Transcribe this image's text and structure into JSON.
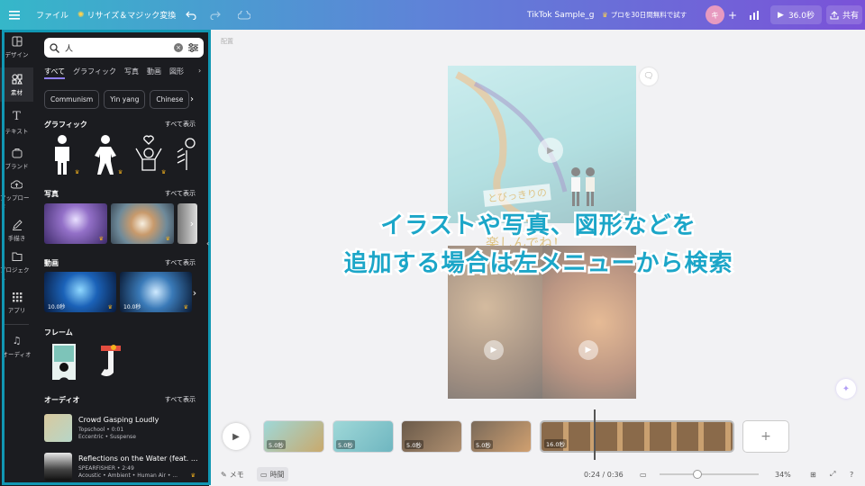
{
  "topbar": {
    "menu_icon": "hamburger-icon",
    "file_label": "ファイル",
    "resize_label": "リサイズ＆マジック変換",
    "title": "TikTok Sample_g",
    "trial_label": "プロを30日間無料で試す",
    "avatar_initial": "キ",
    "add_label": "+",
    "play_label": "36.0秒",
    "share_label": "共有"
  },
  "rail": {
    "items": [
      {
        "label": "デザイン",
        "icon": "layout-icon"
      },
      {
        "label": "素材",
        "icon": "elements-icon"
      },
      {
        "label": "テキスト",
        "icon": "text-icon"
      },
      {
        "label": "ブランド",
        "icon": "brand-icon"
      },
      {
        "label": "アップロード",
        "icon": "upload-icon"
      },
      {
        "label": "手描き",
        "icon": "draw-icon"
      },
      {
        "label": "プロジェクト",
        "icon": "folder-icon"
      },
      {
        "label": "アプリ",
        "icon": "apps-icon"
      },
      {
        "label": "オーディオ",
        "icon": "music-icon"
      }
    ]
  },
  "panel": {
    "search_value": "人",
    "tabs": [
      "すべて",
      "グラフィック",
      "写真",
      "動画",
      "図形"
    ],
    "chips": [
      "Communism",
      "Yin yang",
      "Chinese"
    ],
    "graphics_title": "グラフィック",
    "photos_title": "写真",
    "videos_title": "動画",
    "frames_title": "フレーム",
    "audio_title": "オーディオ",
    "see_all": "すべて表示",
    "videos": [
      {
        "duration": "10.0秒"
      },
      {
        "duration": "10.0秒"
      }
    ],
    "audio": [
      {
        "title": "Crowd Gasping Loudly",
        "meta": "Topschool • 0:01",
        "tags": "Eccentric • Suspense"
      },
      {
        "title": "Reflections on the Water (feat. ...",
        "meta": "SPEARFISHER • 2:49",
        "tags": "Acoustic • Ambient • Human Air • ..."
      }
    ]
  },
  "canvas": {
    "page_label": "配置",
    "caption_line1": "イラストや写真、図形などを",
    "caption_line2": "追加する場合は左メニューから検索",
    "poster_line1": "とびっきりの",
    "poster_line2": "楽しんでね！"
  },
  "timeline": {
    "clips": [
      {
        "duration": "5.0秒"
      },
      {
        "duration": "5.0秒"
      },
      {
        "duration": "5.0秒"
      },
      {
        "duration": "5.0秒"
      },
      {
        "duration": "16.0秒"
      }
    ],
    "add_label": "+"
  },
  "bottom": {
    "notes_label": "メモ",
    "time_label": "時間",
    "time_position": "0:24 / 0:36",
    "zoom_label": "34%",
    "zoom_level": 0.34
  },
  "colors": {
    "accent": "#1197b3",
    "caption": "#1ca6c8",
    "panel_bg": "#1b1c20",
    "tab_underline": "#8f7ef0"
  }
}
